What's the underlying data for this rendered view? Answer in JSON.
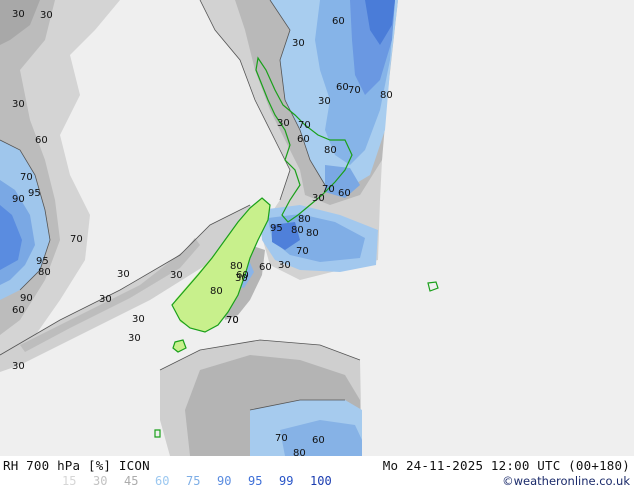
{
  "title": {
    "variable": "RH 700 hPa [%]",
    "model": "ICON",
    "valid_time": "Mo 24-11-2025 12:00 UTC (00+180)",
    "credit": "©weatheronline.co.uk"
  },
  "legend": {
    "levels": [
      {
        "value": "15",
        "color": "#d6d6d6"
      },
      {
        "value": "30",
        "color": "#c2c2c2"
      },
      {
        "value": "45",
        "color": "#acacac"
      },
      {
        "value": "60",
        "color": "#9cc8f0"
      },
      {
        "value": "75",
        "color": "#7eaee6"
      },
      {
        "value": "90",
        "color": "#5a8ce0"
      },
      {
        "value": "95",
        "color": "#3f70d8"
      },
      {
        "value": "99",
        "color": "#2a56c8"
      },
      {
        "value": "100",
        "color": "#1a3cb0"
      }
    ]
  },
  "contour_labels": [
    "30",
    "60",
    "30",
    "60",
    "70",
    "80",
    "30",
    "70",
    "30",
    "80",
    "60",
    "70",
    "60",
    "30",
    "70",
    "60",
    "80",
    "95",
    "80",
    "80",
    "70",
    "60",
    "30",
    "95",
    "30",
    "80",
    "30",
    "30",
    "70",
    "90",
    "70",
    "80",
    "95",
    "30",
    "30",
    "80",
    "60",
    "30",
    "90",
    "60",
    "30",
    "30",
    "30",
    "70",
    "60",
    "80",
    "70"
  ],
  "land_color": "#1aa01a"
}
